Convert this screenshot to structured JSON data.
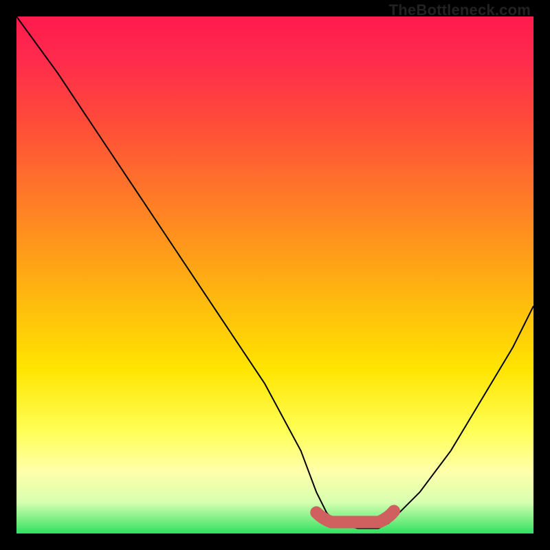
{
  "watermark": "TheBottleneck.com",
  "colors": {
    "frame_border": "#000000",
    "line": "#000000",
    "accent": "#d06060",
    "gradient_top": "#ff1a4d",
    "gradient_bottom": "#30e060"
  },
  "chart_data": {
    "type": "line",
    "title": "",
    "xlabel": "",
    "ylabel": "",
    "xlim": [
      0,
      100
    ],
    "ylim": [
      0,
      100
    ],
    "grid": false,
    "series": [
      {
        "name": "bottleneck-curve",
        "x": [
          0,
          8,
          16,
          24,
          32,
          40,
          48,
          55,
          58,
          60,
          62,
          66,
          70,
          72,
          74,
          78,
          84,
          90,
          96,
          100
        ],
        "y": [
          100,
          89,
          77,
          65,
          53,
          41,
          29,
          16,
          8,
          4,
          2,
          1,
          1,
          2,
          4,
          8,
          16,
          26,
          36,
          44
        ]
      }
    ],
    "annotations": [
      {
        "name": "valley-highlight",
        "shape": "rounded-segment",
        "x_start": 58,
        "x_end": 73,
        "y": 3,
        "color": "#d06060"
      }
    ]
  }
}
